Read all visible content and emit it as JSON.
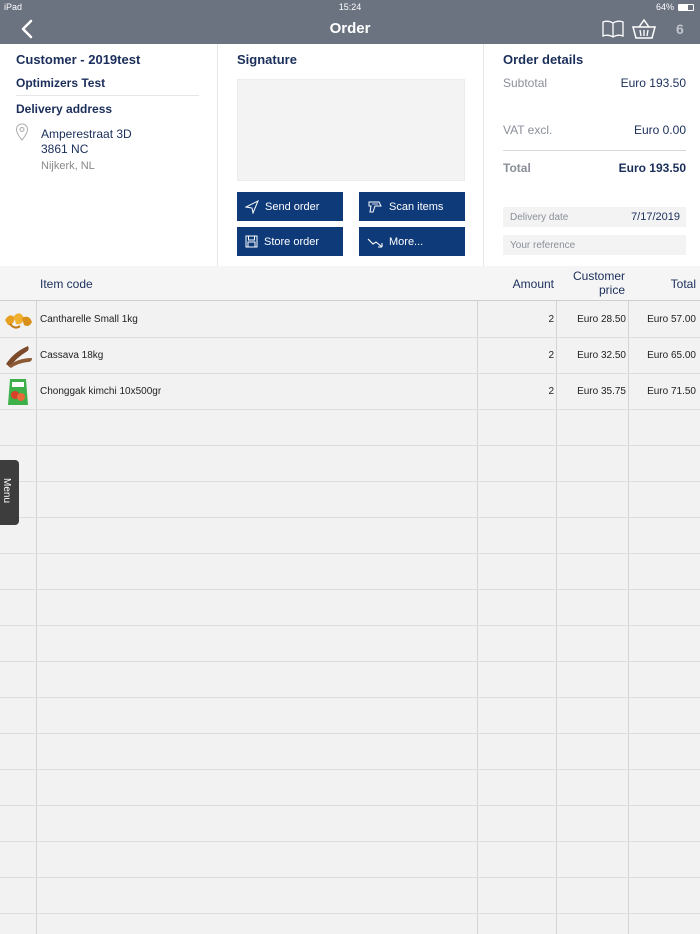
{
  "status": {
    "device": "iPad",
    "time": "15:24",
    "battery": "64%",
    "battery_level": 0.64
  },
  "nav": {
    "title": "Order",
    "basket_count": "6"
  },
  "customer": {
    "title": "Customer - 2019test",
    "name": "Optimizers Test",
    "delivery_label": "Delivery address",
    "address_line1": "Amperestraat 3D",
    "address_line2": "3861 NC",
    "address_line3": "Nijkerk, NL"
  },
  "signature": {
    "title": "Signature",
    "buttons": {
      "send": "Send order",
      "scan": "Scan items",
      "store": "Store order",
      "more": "More..."
    }
  },
  "details": {
    "title": "Order details",
    "subtotal_label": "Subtotal",
    "subtotal_value": "Euro 193.50",
    "vat_label": "VAT excl.",
    "vat_value": "Euro 0.00",
    "total_label": "Total",
    "total_value": "Euro 193.50",
    "delivery_date_label": "Delivery date",
    "delivery_date_value": "7/17/2019",
    "reference_placeholder": "Your reference"
  },
  "table": {
    "headers": {
      "code": "Item code",
      "amount": "Amount",
      "price_line1": "Customer",
      "price_line2": "price",
      "total": "Total"
    },
    "rows": [
      {
        "code": "Cantharelle Small 1kg",
        "amount": "2",
        "price": "Euro 28.50",
        "total": "Euro 57.00",
        "thumb": "mushroom-thumb"
      },
      {
        "code": "Cassava 18kg",
        "amount": "2",
        "price": "Euro 32.50",
        "total": "Euro 65.00",
        "thumb": "cassava-thumb"
      },
      {
        "code": "Chonggak kimchi 10x500gr",
        "amount": "2",
        "price": "Euro 35.75",
        "total": "Euro 71.50",
        "thumb": "kimchi-thumb"
      }
    ]
  },
  "menu_tab": "Menu",
  "colors": {
    "navbar": "#6b7280",
    "primary": "#0e3a7a",
    "heading": "#1a2e5a"
  }
}
